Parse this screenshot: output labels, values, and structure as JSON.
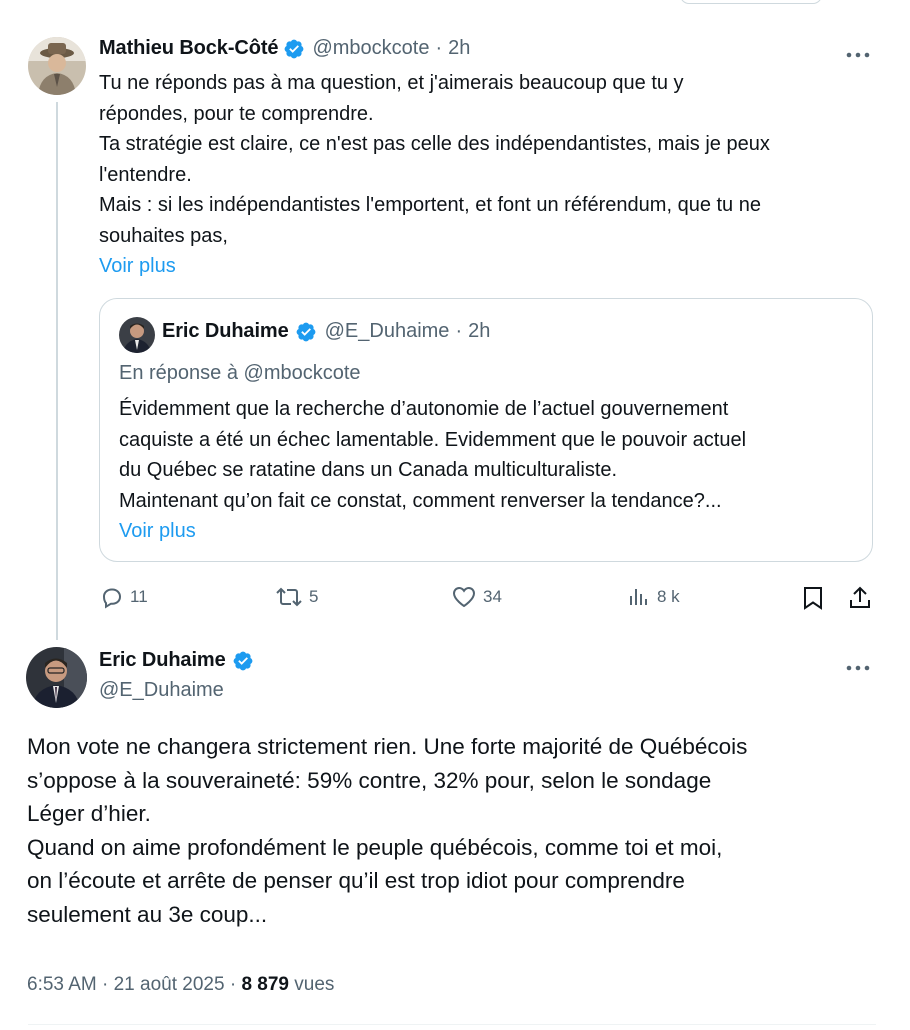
{
  "reply_tweet": {
    "author_name": "Mathieu Bock-Côté",
    "handle": "@mbockcote",
    "separator": "·",
    "time": "2h",
    "lines": [
      "Tu ne réponds pas à ma question, et j'aimerais beaucoup que tu y",
      "répondes, pour te comprendre.",
      "Ta stratégie est claire, ce n'est pas celle des indépendantistes, mais je peux",
      "l'entendre.",
      "Mais : si les indépendantistes l'emportent, et font un référendum, que tu ne",
      "souhaites pas,"
    ],
    "show_more": "Voir plus",
    "quote": {
      "author_name": "Eric Duhaime",
      "handle": "@E_Duhaime",
      "separator": "·",
      "time": "2h",
      "reply_context": "En réponse à @mbockcote",
      "lines": [
        "Évidemment que la recherche d’autonomie de l’actuel gouvernement",
        "caquiste a été un échec lamentable. Evidemment que le pouvoir actuel",
        "du Québec se ratatine dans un Canada multiculturaliste.",
        "Maintenant qu’on fait ce constat, comment renverser la tendance?..."
      ],
      "show_more": "Voir plus"
    },
    "actions": {
      "replies": "11",
      "reposts": "5",
      "likes": "34",
      "views": "8 k"
    }
  },
  "main_tweet": {
    "author_name": "Eric Duhaime",
    "handle": "@E_Duhaime",
    "lines": [
      "Mon vote ne changera strictement rien. Une forte majorité de Québécois",
      "s’oppose à la souveraineté: 59% contre, 32% pour, selon le sondage",
      "Léger d’hier.",
      "Quand on aime profondément le peuple québécois, comme toi et moi,",
      "on l’écoute et arrête de penser qu’il est trop idiot pour comprendre",
      "seulement au 3e coup..."
    ],
    "time": "6:53 AM",
    "separator": "·",
    "date": "21 août 2025",
    "separator2": "·",
    "views_count": "8 879",
    "views_label": "vues"
  },
  "icons": {
    "more": "more-options-icon",
    "verified": "verified-badge-icon",
    "reply": "reply-icon",
    "repost": "repost-icon",
    "like": "like-icon",
    "views": "views-icon",
    "bookmark": "bookmark-icon",
    "share": "share-icon"
  },
  "colors": {
    "accent": "#1d9bf0",
    "muted": "#536471",
    "text": "#0f1419",
    "border": "#cfd9de"
  }
}
